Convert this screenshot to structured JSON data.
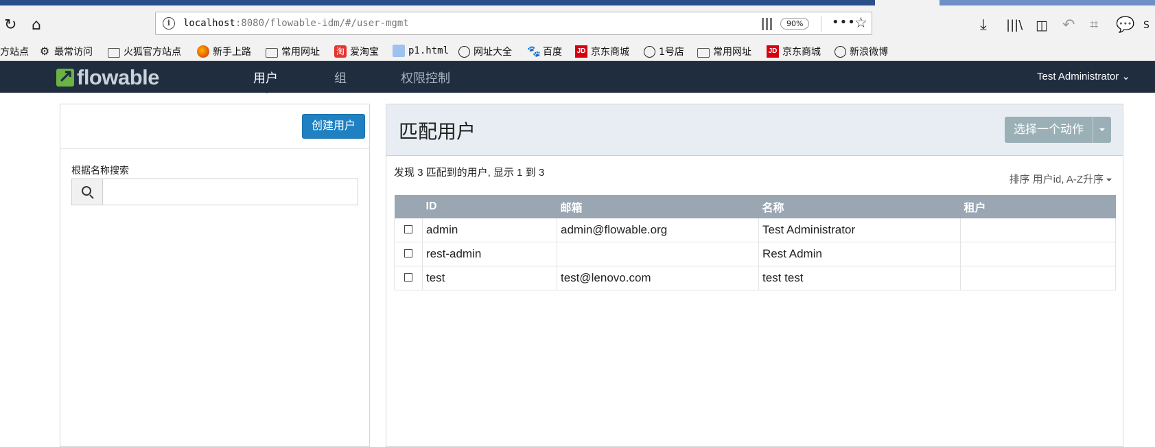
{
  "browser": {
    "url_host": "localhost",
    "url_rest": ":8080/flowable-idm/#/user-mgmt",
    "zoom": "90%",
    "bookmarks": [
      {
        "label": "方站点",
        "icon": "none"
      },
      {
        "label": "最常访问",
        "icon": "gear-icon"
      },
      {
        "label": "火狐官方站点",
        "icon": "folder-icon"
      },
      {
        "label": "新手上路",
        "icon": "firefox-icon"
      },
      {
        "label": "常用网址",
        "icon": "folder-icon"
      },
      {
        "label": "爱淘宝",
        "icon": "taobao-icon"
      },
      {
        "label": "p1.html",
        "icon": "image-icon"
      },
      {
        "label": "网址大全",
        "icon": "globe-icon"
      },
      {
        "label": "百度",
        "icon": "baidu-icon"
      },
      {
        "label": "京东商城",
        "icon": "jd-icon"
      },
      {
        "label": "1号店",
        "icon": "globe-icon"
      },
      {
        "label": "常用网址",
        "icon": "folder-icon"
      },
      {
        "label": "京东商城",
        "icon": "jd-icon"
      },
      {
        "label": "新浪微博",
        "icon": "globe-icon"
      }
    ]
  },
  "navbar": {
    "logo_text": "flowable",
    "items": [
      "用户",
      "组",
      "权限控制"
    ],
    "active_index": 0,
    "user": "Test Administrator"
  },
  "left": {
    "create_button": "创建用户",
    "search_label": "根据名称搜索",
    "search_value": ""
  },
  "right": {
    "title": "匹配用户",
    "action_button": "选择一个动作",
    "summary": "发现 3 匹配到的用户, 显示 1 到 3",
    "sort_label": "排序 用户id, A-Z升序",
    "columns": [
      "ID",
      "邮箱",
      "名称",
      "租户"
    ],
    "rows": [
      {
        "id": "admin",
        "email": "admin@flowable.org",
        "name": "Test Administrator",
        "tenant": ""
      },
      {
        "id": "rest-admin",
        "email": "",
        "name": "Rest Admin",
        "tenant": ""
      },
      {
        "id": "test",
        "email": "test@lenovo.com",
        "name": "test test",
        "tenant": ""
      }
    ]
  },
  "colors": {
    "navbar_bg": "#1f2d3f",
    "primary_button": "#2081c2",
    "action_button": "#9ab0b6",
    "table_header": "#9aa6b2",
    "logo_green": "#6ab344"
  }
}
